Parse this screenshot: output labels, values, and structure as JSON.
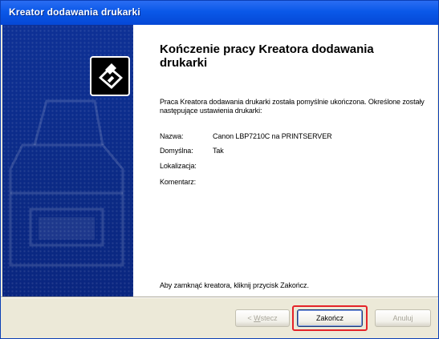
{
  "window": {
    "title": "Kreator dodawania drukarki"
  },
  "content": {
    "heading": "Kończenie pracy Kreatora dodawania drukarki",
    "paragraph": "Praca Kreatora dodawania drukarki została pomyślnie ukończona. Określone zostały następujące ustawienia drukarki:",
    "fields": [
      {
        "label": "Nazwa:",
        "value": "Canon LBP7210C na PRINTSERVER"
      },
      {
        "label": "Domyślna:",
        "value": "Tak"
      },
      {
        "label": "Lokalizacja:",
        "value": ""
      },
      {
        "label": "Komentarz:",
        "value": ""
      }
    ],
    "footer_text": "Aby zamknąć kreatora, kliknij przycisk Zakończ."
  },
  "buttons": {
    "back": {
      "prefix": "< ",
      "underlined": "W",
      "rest": "stecz"
    },
    "finish": "Zakończ",
    "cancel": "Anuluj"
  },
  "colors": {
    "titlebar": "#0a58e8",
    "sidepanel": "#0c2a8a",
    "highlight": "#e52329"
  },
  "icons": {
    "side_illustration": "printer-icon"
  }
}
